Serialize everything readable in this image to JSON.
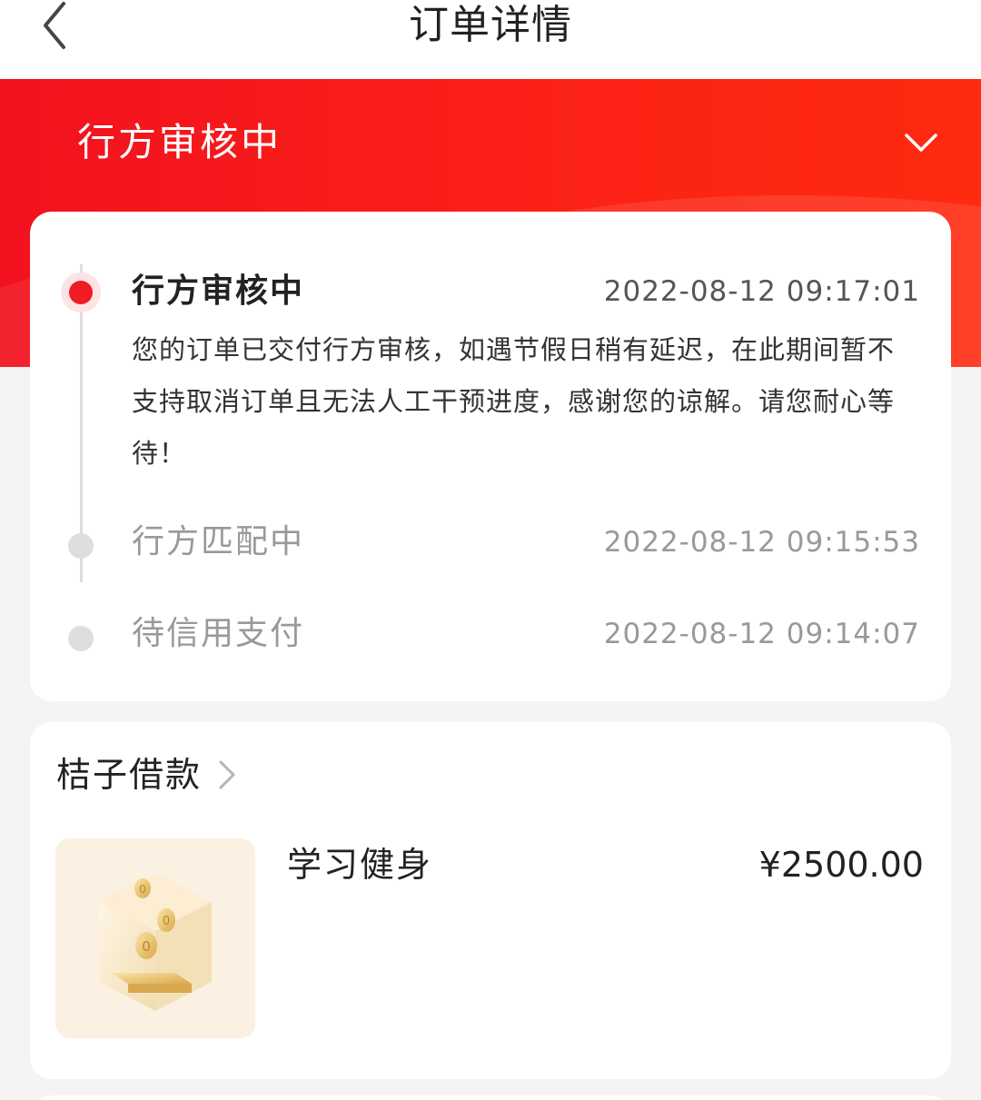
{
  "nav": {
    "title": "订单详情"
  },
  "banner": {
    "status": "行方审核中"
  },
  "timeline": [
    {
      "title": "行方审核中",
      "time": "2022-08-12 09:17:01",
      "desc": "您的订单已交付行方审核，如遇节假日稍有延迟，在此期间暂不支持取消订单且无法人工干预进度，感谢您的谅解。请您耐心等待！",
      "active": true
    },
    {
      "title": "行方匹配中",
      "time": "2022-08-12 09:15:53",
      "active": false
    },
    {
      "title": "待信用支付",
      "time": "2022-08-12 09:14:07",
      "active": false
    }
  ],
  "product": {
    "shop": "桔子借款",
    "name": "学习健身",
    "price": "¥2500.00",
    "thumb_icon": "coin-box-icon"
  },
  "colors": {
    "accent": "#f2121f",
    "active_dot": "#ef1b25",
    "muted": "#999999"
  },
  "icons": {
    "back": "chevron-left-icon",
    "toggle": "chevron-down-icon",
    "shop_arrow": "chevron-right-icon"
  }
}
